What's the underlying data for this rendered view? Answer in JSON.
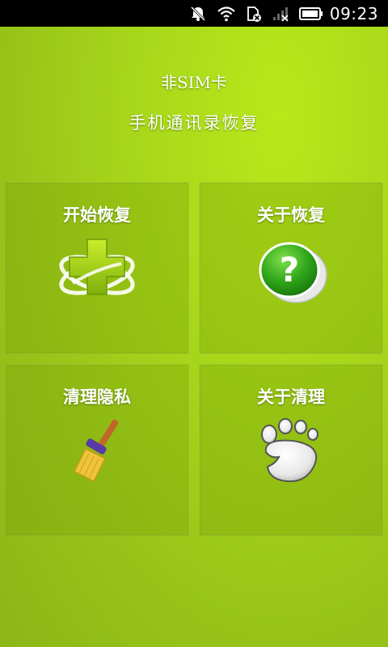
{
  "status_bar": {
    "time": "09:23",
    "icons": [
      "notifications-off-icon",
      "wifi-icon",
      "sim-error-icon",
      "signal-icon",
      "battery-icon"
    ]
  },
  "header": {
    "title": "非SIM卡",
    "subtitle": "手机通讯录恢复"
  },
  "tiles": [
    {
      "label": "开始恢复",
      "icon": "medical-cross-icon"
    },
    {
      "label": "关于恢复",
      "icon": "question-icon"
    },
    {
      "label": "清理隐私",
      "icon": "broom-icon"
    },
    {
      "label": "关于清理",
      "icon": "footprint-icon"
    }
  ],
  "colors": {
    "background": "#a8d81a",
    "tile": "#8cb314",
    "text": "#ffffff",
    "status_bar": "#000000"
  }
}
